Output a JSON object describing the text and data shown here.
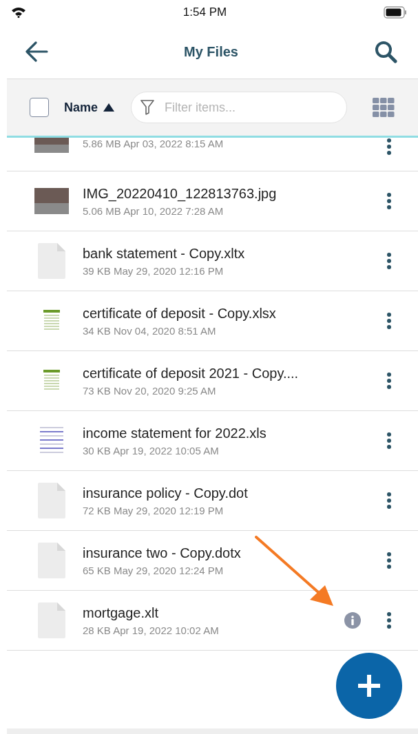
{
  "status_bar": {
    "time": "1:54 PM"
  },
  "header": {
    "title": "My Files"
  },
  "toolbar": {
    "select_all": {
      "checked": false
    },
    "sort": {
      "label": "Name"
    },
    "filter": {
      "placeholder": "Filter items..."
    }
  },
  "files": [
    {
      "kind": "photo",
      "meta": "5.86 MB Apr 03, 2022 8:15 AM",
      "info": false
    },
    {
      "kind": "photo",
      "name": "IMG_20220410_122813763.jpg",
      "meta": "5.06 MB Apr 10, 2022 7:28 AM",
      "info": false
    },
    {
      "kind": "blank",
      "name": "bank statement - Copy.xltx",
      "meta": "39 KB May 29, 2020 12:16 PM",
      "info": false
    },
    {
      "kind": "sheet",
      "name": "certificate of deposit - Copy.xlsx",
      "meta": "34 KB Nov 04, 2020 8:51 AM",
      "info": false
    },
    {
      "kind": "sheet",
      "name": "certificate of deposit 2021 - Copy....",
      "meta": "73 KB Nov 20, 2020 9:25 AM",
      "info": false
    },
    {
      "kind": "doc",
      "name": "income statement for 2022.xls",
      "meta": "30 KB Apr 19, 2022 10:05 AM",
      "info": false
    },
    {
      "kind": "blank",
      "name": "insurance policy - Copy.dot",
      "meta": "72 KB May 29, 2020 12:19 PM",
      "info": false
    },
    {
      "kind": "blank",
      "name": "insurance two - Copy.dotx",
      "meta": "65 KB May 29, 2020 12:24 PM",
      "info": false
    },
    {
      "kind": "blank",
      "name": "mortgage.xlt",
      "meta": "28 KB Apr 19, 2022 10:02 AM",
      "info": true
    }
  ]
}
